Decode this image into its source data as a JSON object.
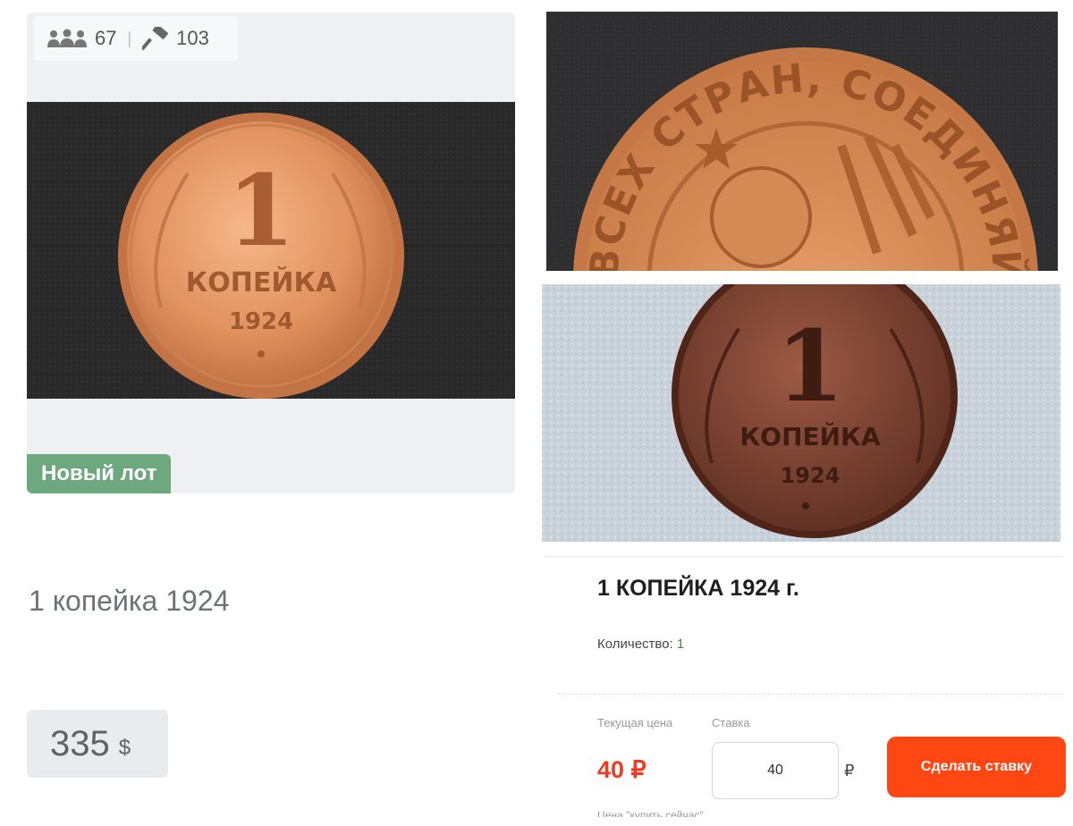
{
  "left": {
    "stats": {
      "watchers": "67",
      "bids": "103"
    },
    "badge": "Новый лот",
    "title": "1 копейка 1924",
    "price": {
      "value": "335",
      "currency": "$"
    },
    "coin": {
      "numeral": "1",
      "word": "КОПЕЙКА",
      "year": "1924"
    }
  },
  "right": {
    "top_photo": {
      "legend": "ВСЕХ СТРАН, СОЕДИНЯЙТЕСЬ!"
    },
    "coin": {
      "numeral": "1",
      "word": "КОПЕЙКА",
      "year": "1924"
    },
    "title": "1 КОПЕЙКА 1924 г.",
    "quantity_label": "Количество:",
    "quantity_value": "1",
    "current_price_label": "Текущая цена",
    "bid_label": "Ставка",
    "current_price": "40 ₽",
    "bid_value": "40",
    "bid_currency": "₽",
    "bid_button": "Сделать ставку",
    "buy_now_label": "Цена \"купить сейчас\""
  },
  "colors": {
    "badge": "#6ea87e",
    "accent": "#ff4713",
    "price_red": "#ee3b22"
  },
  "icons": {
    "watchers": "people-group-icon",
    "bids": "gavel-icon"
  }
}
